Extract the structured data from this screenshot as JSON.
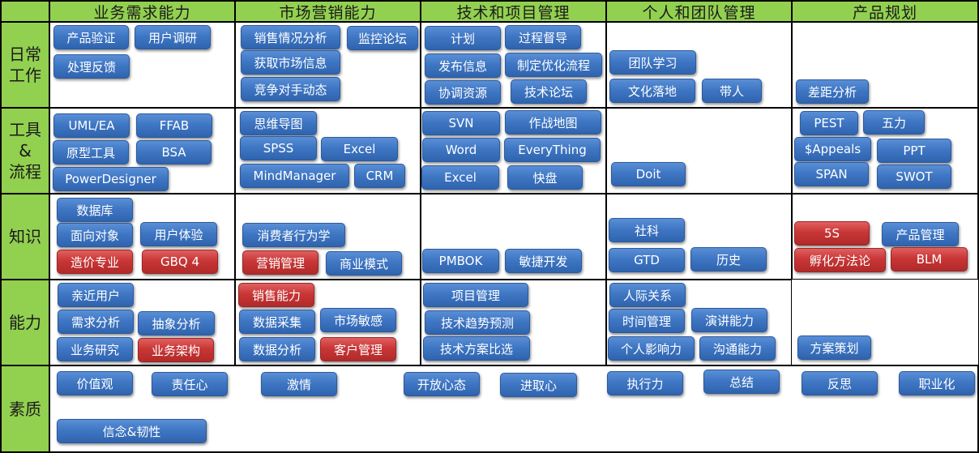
{
  "colors": {
    "header_bg": "#92d050",
    "blue_button": "#3f77c4",
    "red_button": "#c93636",
    "border": "#000000"
  },
  "columns": [
    {
      "key": "business",
      "label": "业务需求能力"
    },
    {
      "key": "marketing",
      "label": "市场营销能力"
    },
    {
      "key": "tech",
      "label": "技术和项目管理"
    },
    {
      "key": "team",
      "label": "个人和团队管理"
    },
    {
      "key": "product",
      "label": "产品规划"
    }
  ],
  "rows": [
    {
      "key": "daily",
      "label": "日常\n工作"
    },
    {
      "key": "tools",
      "label": "工具\n&\n流程"
    },
    {
      "key": "knowledge",
      "label": "知识"
    },
    {
      "key": "ability",
      "label": "能力"
    },
    {
      "key": "quality",
      "label": "素质"
    }
  ],
  "items": {
    "daily": {
      "business": [
        {
          "label": "产品验证",
          "color": "blue"
        },
        {
          "label": "用户调研",
          "color": "blue"
        },
        {
          "label": "处理反馈",
          "color": "blue"
        }
      ],
      "marketing": [
        {
          "label": "销售情况分析",
          "color": "blue"
        },
        {
          "label": "监控论坛",
          "color": "blue"
        },
        {
          "label": "获取市场信息",
          "color": "blue"
        },
        {
          "label": "竞争对手动态",
          "color": "blue"
        }
      ],
      "tech": [
        {
          "label": "计划",
          "color": "blue"
        },
        {
          "label": "过程督导",
          "color": "blue"
        },
        {
          "label": "发布信息",
          "color": "blue"
        },
        {
          "label": "制定优化流程",
          "color": "blue"
        },
        {
          "label": "协调资源",
          "color": "blue"
        },
        {
          "label": "技术论坛",
          "color": "blue"
        }
      ],
      "team": [
        {
          "label": "团队学习",
          "color": "blue"
        },
        {
          "label": "文化落地",
          "color": "blue"
        },
        {
          "label": "带人",
          "color": "blue"
        }
      ],
      "product": [
        {
          "label": "差距分析",
          "color": "blue"
        }
      ]
    },
    "tools": {
      "business": [
        {
          "label": "UML/EA",
          "color": "blue"
        },
        {
          "label": "FFAB",
          "color": "blue"
        },
        {
          "label": "原型工具",
          "color": "blue"
        },
        {
          "label": "BSA",
          "color": "blue"
        },
        {
          "label": "PowerDesigner",
          "color": "blue"
        }
      ],
      "marketing": [
        {
          "label": "思维导图",
          "color": "blue"
        },
        {
          "label": "SPSS",
          "color": "blue"
        },
        {
          "label": "Excel",
          "color": "blue"
        },
        {
          "label": "MindManager",
          "color": "blue"
        },
        {
          "label": "CRM",
          "color": "blue"
        }
      ],
      "tech": [
        {
          "label": "SVN",
          "color": "blue"
        },
        {
          "label": "作战地图",
          "color": "blue"
        },
        {
          "label": "Word",
          "color": "blue"
        },
        {
          "label": "EveryThing",
          "color": "blue"
        },
        {
          "label": "Excel",
          "color": "blue"
        },
        {
          "label": "快盘",
          "color": "blue"
        }
      ],
      "team": [
        {
          "label": "Doit",
          "color": "blue"
        }
      ],
      "product": [
        {
          "label": "PEST",
          "color": "blue"
        },
        {
          "label": "五力",
          "color": "blue"
        },
        {
          "label": "$Appeals",
          "color": "blue"
        },
        {
          "label": "PPT",
          "color": "blue"
        },
        {
          "label": "SPAN",
          "color": "blue"
        },
        {
          "label": "SWOT",
          "color": "blue"
        }
      ]
    },
    "knowledge": {
      "business": [
        {
          "label": "数据库",
          "color": "blue"
        },
        {
          "label": "面向对象",
          "color": "blue"
        },
        {
          "label": "用户体验",
          "color": "blue"
        },
        {
          "label": "造价专业",
          "color": "red"
        },
        {
          "label": "GBQ 4",
          "color": "red"
        }
      ],
      "marketing": [
        {
          "label": "消费者行为学",
          "color": "blue"
        },
        {
          "label": "营销管理",
          "color": "red"
        },
        {
          "label": "商业模式",
          "color": "blue"
        }
      ],
      "tech": [
        {
          "label": "PMBOK",
          "color": "blue"
        },
        {
          "label": "敏捷开发",
          "color": "blue"
        }
      ],
      "team": [
        {
          "label": "社科",
          "color": "blue"
        },
        {
          "label": "GTD",
          "color": "blue"
        },
        {
          "label": "历史",
          "color": "blue"
        }
      ],
      "product": [
        {
          "label": "5S",
          "color": "red"
        },
        {
          "label": "产品管理",
          "color": "blue"
        },
        {
          "label": "孵化方法论",
          "color": "red"
        },
        {
          "label": "BLM",
          "color": "red"
        }
      ]
    },
    "ability": {
      "business": [
        {
          "label": "亲近用户",
          "color": "blue"
        },
        {
          "label": "需求分析",
          "color": "blue"
        },
        {
          "label": "抽象分析",
          "color": "blue"
        },
        {
          "label": "业务研究",
          "color": "blue"
        },
        {
          "label": "业务架构",
          "color": "red"
        }
      ],
      "marketing": [
        {
          "label": "销售能力",
          "color": "red"
        },
        {
          "label": "数据采集",
          "color": "blue"
        },
        {
          "label": "市场敏感",
          "color": "blue"
        },
        {
          "label": "数据分析",
          "color": "blue"
        },
        {
          "label": "客户管理",
          "color": "red"
        }
      ],
      "tech": [
        {
          "label": "项目管理",
          "color": "blue"
        },
        {
          "label": "技术趋势预测",
          "color": "blue"
        },
        {
          "label": "技术方案比选",
          "color": "blue"
        }
      ],
      "team": [
        {
          "label": "人际关系",
          "color": "blue"
        },
        {
          "label": "时间管理",
          "color": "blue"
        },
        {
          "label": "演讲能力",
          "color": "blue"
        },
        {
          "label": "个人影响力",
          "color": "blue"
        },
        {
          "label": "沟通能力",
          "color": "blue"
        }
      ],
      "product": [
        {
          "label": "方案策划",
          "color": "blue"
        }
      ]
    },
    "quality": {
      "all": [
        {
          "label": "价值观",
          "color": "blue"
        },
        {
          "label": "责任心",
          "color": "blue"
        },
        {
          "label": "激情",
          "color": "blue"
        },
        {
          "label": "开放心态",
          "color": "blue"
        },
        {
          "label": "进取心",
          "color": "blue"
        },
        {
          "label": "执行力",
          "color": "blue"
        },
        {
          "label": "总结",
          "color": "blue"
        },
        {
          "label": "反思",
          "color": "blue"
        },
        {
          "label": "职业化",
          "color": "blue"
        },
        {
          "label": "信念&韧性",
          "color": "blue"
        }
      ]
    }
  }
}
